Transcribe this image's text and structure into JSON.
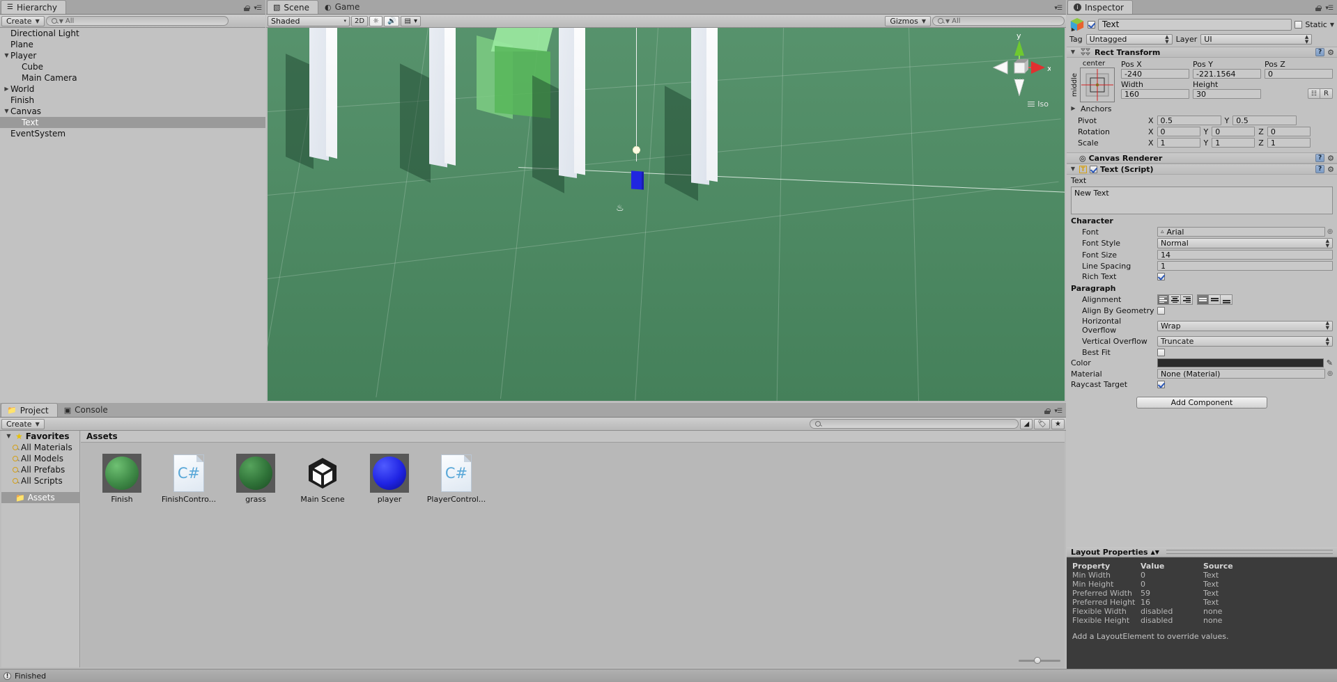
{
  "hierarchy": {
    "tab_label": "Hierarchy",
    "tab_icon": "hierarchy-icon",
    "create_label": "Create",
    "search_placeholder": "All",
    "items": [
      {
        "label": "Directional Light",
        "depth": 1,
        "arrow": "none",
        "selected": false
      },
      {
        "label": "Plane",
        "depth": 1,
        "arrow": "none",
        "selected": false
      },
      {
        "label": "Player",
        "depth": 1,
        "arrow": "down",
        "selected": false
      },
      {
        "label": "Cube",
        "depth": 2,
        "arrow": "none",
        "selected": false
      },
      {
        "label": "Main Camera",
        "depth": 2,
        "arrow": "none",
        "selected": false
      },
      {
        "label": "World",
        "depth": 1,
        "arrow": "right",
        "selected": false
      },
      {
        "label": "Finish",
        "depth": 1,
        "arrow": "none",
        "selected": false
      },
      {
        "label": "Canvas",
        "depth": 1,
        "arrow": "down",
        "selected": false
      },
      {
        "label": "Text",
        "depth": 2,
        "arrow": "none",
        "selected": true
      },
      {
        "label": "EventSystem",
        "depth": 1,
        "arrow": "none",
        "selected": false
      }
    ]
  },
  "scene": {
    "tab_scene": "Scene",
    "tab_game": "Game",
    "shading_mode": "Shaded",
    "mode_2d": "2D",
    "lighting_icon": "sun-icon",
    "audio_icon": "speaker-icon",
    "effects_icon": "image-icon",
    "gizmos_label": "Gizmos",
    "search_placeholder": "All",
    "axis_y": "y",
    "axis_x": "x",
    "projection_label": "Iso"
  },
  "project": {
    "tab_project": "Project",
    "tab_console": "Console",
    "create_label": "Create",
    "search_placeholder": "",
    "favorites_label": "Favorites",
    "favorites": [
      "All Materials",
      "All Models",
      "All Prefabs",
      "All Scripts"
    ],
    "assets_folder": "Assets",
    "assets_header": "Assets",
    "assets": [
      {
        "name": "Finish",
        "kind": "material-green"
      },
      {
        "name": "FinishContro...",
        "kind": "csharp-script"
      },
      {
        "name": "grass",
        "kind": "material-darkgreen"
      },
      {
        "name": "Main Scene",
        "kind": "unity-scene"
      },
      {
        "name": "player",
        "kind": "material-blue"
      },
      {
        "name": "PlayerControl...",
        "kind": "csharp-script"
      }
    ]
  },
  "inspector": {
    "tab_label": "Inspector",
    "object_name": "Text",
    "enabled": true,
    "static_label": "Static",
    "tag_label": "Tag",
    "tag_value": "Untagged",
    "layer_label": "Layer",
    "layer_value": "UI",
    "rect_transform": {
      "title": "Rect Transform",
      "anchor_preset_top": "center",
      "anchor_preset_side": "middle",
      "pos_x_label": "Pos X",
      "pos_y_label": "Pos Y",
      "pos_z_label": "Pos Z",
      "pos_x": "-240",
      "pos_y": "-221.1564",
      "pos_z": "0",
      "width_label": "Width",
      "height_label": "Height",
      "width": "160",
      "height": "30",
      "blueprint_icon": "blueprint-icon",
      "raw_label": "R",
      "anchors_label": "Anchors",
      "pivot_label": "Pivot",
      "pivot_x": "0.5",
      "pivot_y": "0.5",
      "rotation_label": "Rotation",
      "rotation_x": "0",
      "rotation_y": "0",
      "rotation_z": "0",
      "scale_label": "Scale",
      "scale_x": "1",
      "scale_y": "1",
      "scale_z": "1",
      "x_label": "X",
      "y_label": "Y",
      "z_label": "Z"
    },
    "canvas_renderer": {
      "title": "Canvas Renderer"
    },
    "text_script": {
      "title": "Text (Script)",
      "enabled": true,
      "text_label": "Text",
      "text_value": "New Text",
      "character_header": "Character",
      "font_label": "Font",
      "font_value": "Arial",
      "font_style_label": "Font Style",
      "font_style_value": "Normal",
      "font_size_label": "Font Size",
      "font_size_value": "14",
      "line_spacing_label": "Line Spacing",
      "line_spacing_value": "1",
      "rich_text_label": "Rich Text",
      "rich_text_checked": true,
      "paragraph_header": "Paragraph",
      "alignment_label": "Alignment",
      "alignment_horizontal": "left",
      "alignment_vertical": "top",
      "align_by_geometry_label": "Align By Geometry",
      "align_by_geometry_checked": false,
      "horizontal_overflow_label": "Horizontal Overflow",
      "horizontal_overflow_value": "Wrap",
      "vertical_overflow_label": "Vertical Overflow",
      "vertical_overflow_value": "Truncate",
      "best_fit_label": "Best Fit",
      "best_fit_checked": false,
      "color_label": "Color",
      "color_value": "#2b2b2b",
      "material_label": "Material",
      "material_value": "None (Material)",
      "raycast_target_label": "Raycast Target",
      "raycast_target_checked": true
    },
    "add_component_label": "Add Component",
    "layout_properties": {
      "title": "Layout Properties",
      "columns": [
        "Property",
        "Value",
        "Source"
      ],
      "rows": [
        [
          "Min Width",
          "0",
          "Text"
        ],
        [
          "Min Height",
          "0",
          "Text"
        ],
        [
          "Preferred Width",
          "59",
          "Text"
        ],
        [
          "Preferred Height",
          "16",
          "Text"
        ],
        [
          "Flexible Width",
          "disabled",
          "none"
        ],
        [
          "Flexible Height",
          "disabled",
          "none"
        ]
      ],
      "note": "Add a LayoutElement to override values."
    }
  },
  "statusbar": {
    "message": "Finished",
    "icon": "info-icon"
  }
}
